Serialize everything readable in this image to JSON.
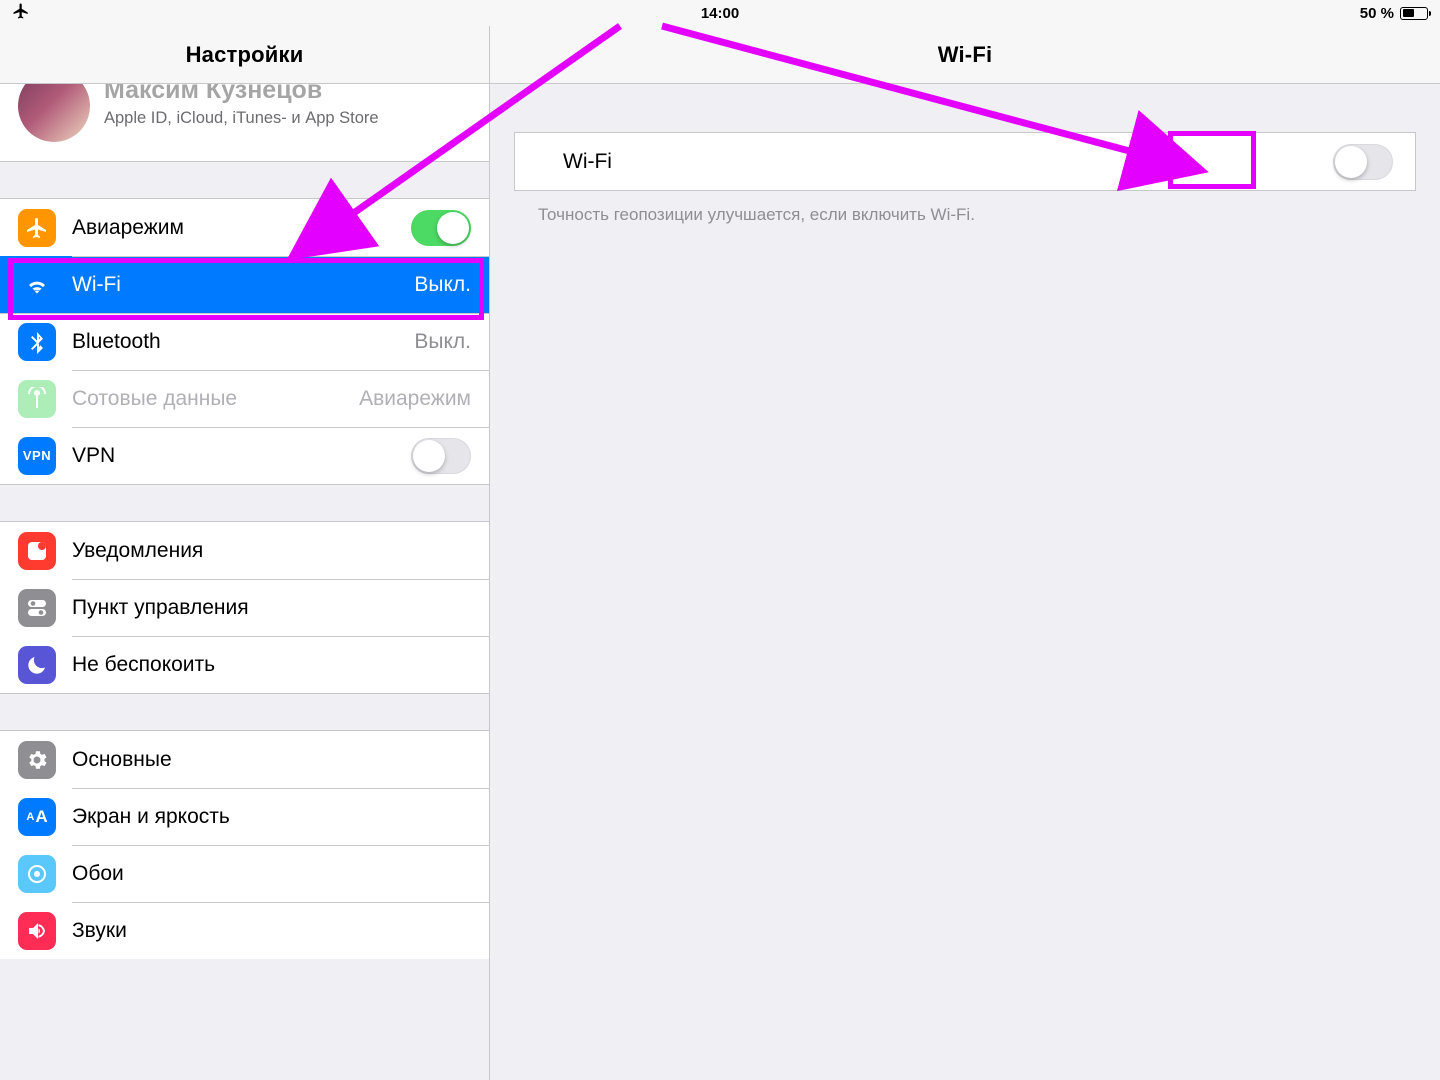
{
  "status": {
    "time": "14:00",
    "battery_text": "50 %"
  },
  "sidebar": {
    "title": "Настройки",
    "account": {
      "name": "Максим Кузнецов",
      "subtitle": "Apple ID, iCloud, iTunes- и App Store"
    },
    "group1": {
      "airplane": {
        "label": "Авиарежим",
        "on": true
      },
      "wifi": {
        "label": "Wi-Fi",
        "value": "Выкл.",
        "selected": true
      },
      "bluetooth": {
        "label": "Bluetooth",
        "value": "Выкл."
      },
      "cellular": {
        "label": "Сотовые данные",
        "value": "Авиарежим",
        "disabled": true
      },
      "vpn": {
        "label": "VPN",
        "on": false
      }
    },
    "group2": {
      "notifications": {
        "label": "Уведомления"
      },
      "control_center": {
        "label": "Пункт управления"
      },
      "dnd": {
        "label": "Не беспокоить"
      }
    },
    "group3": {
      "general": {
        "label": "Основные"
      },
      "display": {
        "label": "Экран и яркость"
      },
      "wallpaper": {
        "label": "Обои"
      },
      "sounds": {
        "label": "Звуки"
      }
    }
  },
  "detail": {
    "title": "Wi-Fi",
    "row_label": "Wi-Fi",
    "switch_on": false,
    "hint": "Точность геопозиции улучшается, если включить Wi-Fi."
  },
  "colors": {
    "orange": "#ff9500",
    "blue": "#007aff",
    "green": "#4cd964",
    "grey": "#8e8e93",
    "red": "#ff3b30",
    "purple": "#5856d6",
    "teal": "#5ac8fa",
    "lightblue": "#34aadc",
    "darknavy": "#0a3572"
  }
}
